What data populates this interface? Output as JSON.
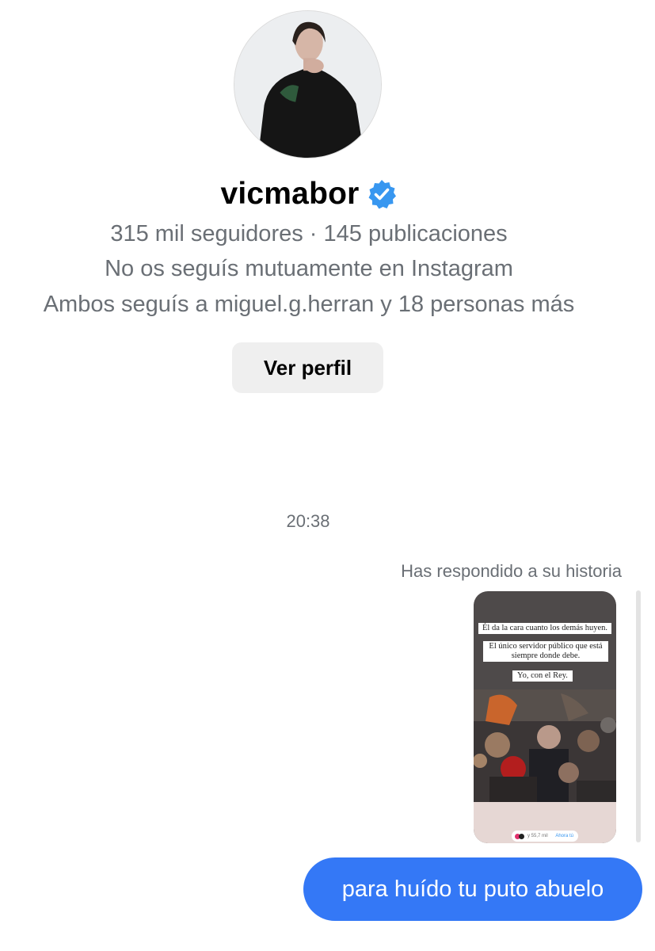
{
  "profile": {
    "username": "vicmabor",
    "verified_icon": "verified-badge-icon",
    "stats": "315 mil seguidores · 145 publicaciones",
    "follow_status": "No os seguís mutuamente en Instagram",
    "mutuals": "Ambos seguís a miguel.g.herran y 18 personas más",
    "view_profile_label": "Ver perfil"
  },
  "conversation": {
    "timestamp": "20:38",
    "story_reply_label": "Has respondido a su historia",
    "story": {
      "caption_1": "Él da la cara cuanto los demás huyen.",
      "caption_2": "El único servidor público que está siempre donde debe.",
      "caption_3": "Yo, con el Rey.",
      "pill_text": "y 55,7 mil",
      "pill_reply": "Ahora tú"
    },
    "message": "para huído tu puto abuelo"
  },
  "colors": {
    "bubble": "#3478f6",
    "verified": "#3897f0",
    "secondary_text": "#6a6f75",
    "button_bg": "#efefef"
  }
}
